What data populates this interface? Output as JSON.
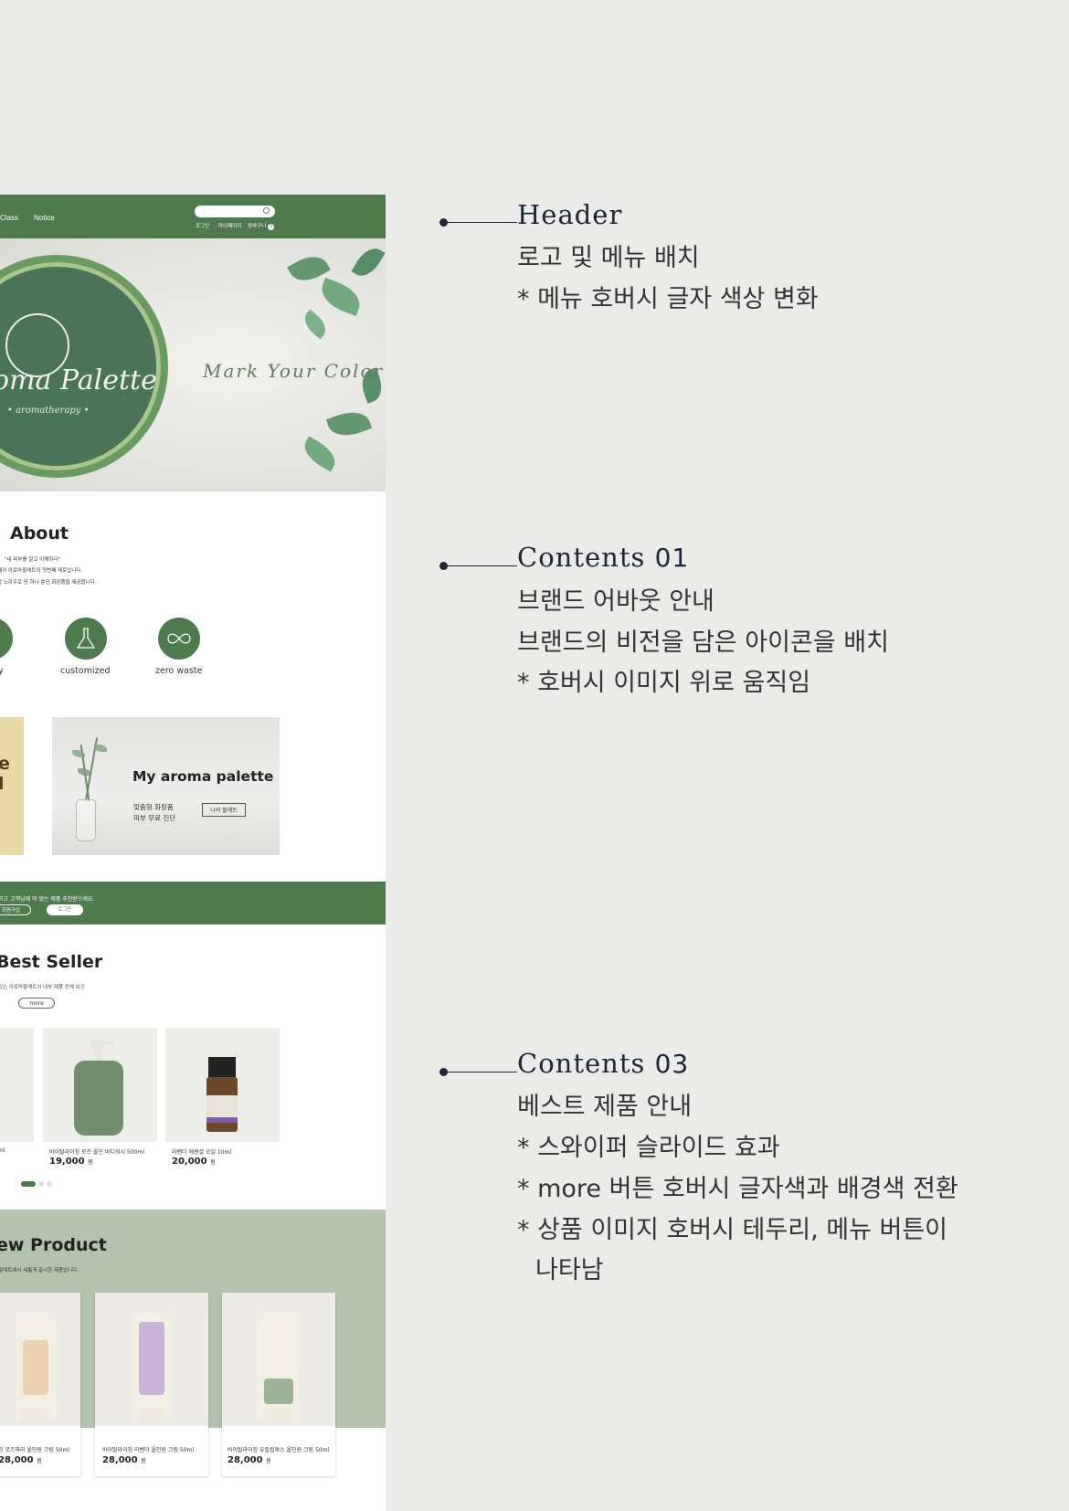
{
  "header": {
    "nav": [
      "Class",
      "Notice"
    ],
    "search_placeholder": "",
    "utility": [
      "로그인",
      "마이페이지",
      "장바구니"
    ],
    "cart_count": "0"
  },
  "hero": {
    "brand": "oma Palette",
    "brand_sub": "• aromatherapy •",
    "tagline": "Mark Your Color"
  },
  "about": {
    "title": "About",
    "lines": [
      "\"내 피부를 알고 이해하다\"",
      "상태가 아로마팔레트의 첫번째 제로입니다.",
      "적합 노하우로 단 하나 뿐인 화장품을 제공합니다."
    ],
    "icons": [
      {
        "label": "y",
        "icon": "shield-icon"
      },
      {
        "label": "customized",
        "icon": "flask-icon"
      },
      {
        "label": "zero waste",
        "icon": "infinity-icon"
      }
    ]
  },
  "promo": {
    "left_text": "e\nl",
    "title": "My aroma palette",
    "sub1": "맞춤형 화장품",
    "sub2": "피부 무료 진단",
    "button": "나의 팔레트"
  },
  "band": {
    "message": "하고 고객님께 딱 맞는 제품 추천받으세요.",
    "signup": "회원가입",
    "login": "로그인"
  },
  "best_seller": {
    "title": "Best Seller",
    "subtitle": "있는 아로마팔레트의 내부 제품 전체 보기",
    "more": "more",
    "products": [
      {
        "name": "ml",
        "price": "",
        "unit": ""
      },
      {
        "name": "바이탈라이징 로즈 올인 바디워시 500ml",
        "price": "19,000",
        "unit": "원"
      },
      {
        "name": "라벤더 에센셜 오일 10ml",
        "price": "20,000",
        "unit": "원"
      }
    ]
  },
  "new_product": {
    "title": "ew Product",
    "subtitle": "팔레트에서 새롭게 출시한 제품입니다.",
    "products": [
      {
        "name": "징 로즈마리 올인원 크림 50ml",
        "price": "28,000",
        "unit": "원",
        "accent": "#e0b27a"
      },
      {
        "name": "바이탈라이징 라벤더 올인원 크림 50ml",
        "price": "28,000",
        "unit": "원",
        "accent": "#a98bc2"
      },
      {
        "name": "바이탈라이징 유칼립투스 올인원 크림 50ml",
        "price": "28,000",
        "unit": "원",
        "accent": "#7a9b72"
      }
    ]
  },
  "annotations": [
    {
      "title": "Header",
      "num": "",
      "lines": [
        "로고 및 메뉴 배치",
        "* 메뉴 호버시 글자 색상 변화"
      ]
    },
    {
      "title": "Contents ",
      "num": "01",
      "lines": [
        "브랜드 어바웃 안내",
        "브랜드의 비전을 담은 아이콘을 배치",
        "* 호버시 이미지 위로 움직임"
      ]
    },
    {
      "title": "Contents ",
      "num": "03",
      "lines": [
        "베스트 제품 안내",
        "* 스와이퍼 슬라이드 효과",
        "* more 버튼 호버시 글자색과 배경색 전환",
        "* 상품 이미지 호버시 테두리, 메뉴 버튼이",
        "나타남"
      ]
    }
  ],
  "colors": {
    "brand_green": "#4e7a4e",
    "page_bg": "#ebebe9",
    "np_bg": "#b3c3ad",
    "ink": "#1e2535"
  }
}
